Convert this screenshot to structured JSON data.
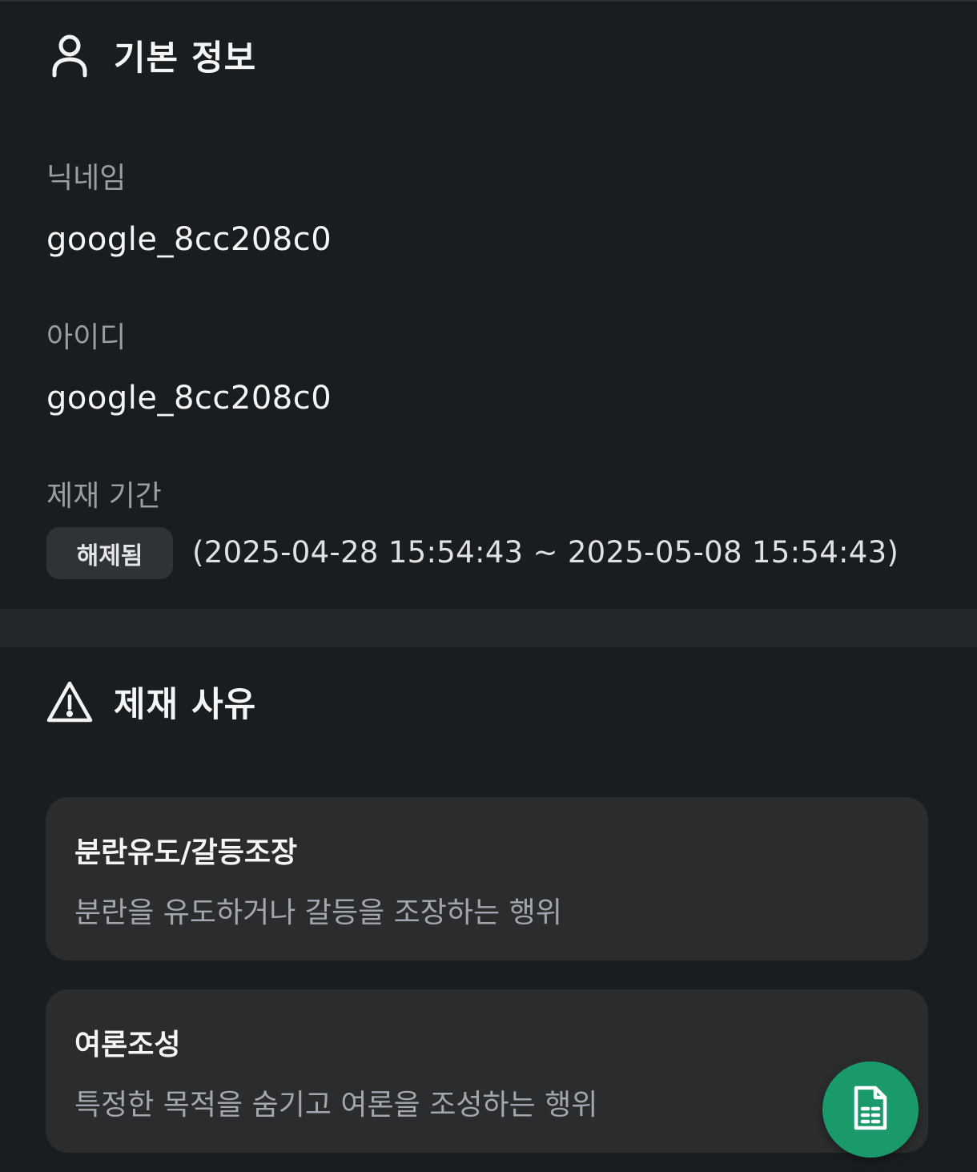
{
  "basic_info": {
    "title": "기본 정보",
    "icon": "person-icon",
    "nickname_label": "닉네임",
    "nickname_value": "google_8cc208c0",
    "id_label": "아이디",
    "id_value": "google_8cc208c0",
    "period_label": "제재 기간",
    "status_badge": "해제됨",
    "period_range": "(2025-04-28 15:54:43 ~ 2025-05-08 15:54:43)"
  },
  "sanction_reason": {
    "title": "제재 사유",
    "icon": "warning-icon",
    "items": [
      {
        "title": "분란유도/갈등조장",
        "description": "분란을 유도하거나 갈등을 조장하는 행위"
      },
      {
        "title": "여론조성",
        "description": "특정한 목적을 숨기고 여론을 조성하는 행위"
      }
    ]
  },
  "fab": {
    "icon": "document-icon",
    "color": "#1a9a6b"
  },
  "colors": {
    "background": "#1a1d1f",
    "card": "#2a2c2e",
    "accent": "#1a9a6b"
  }
}
